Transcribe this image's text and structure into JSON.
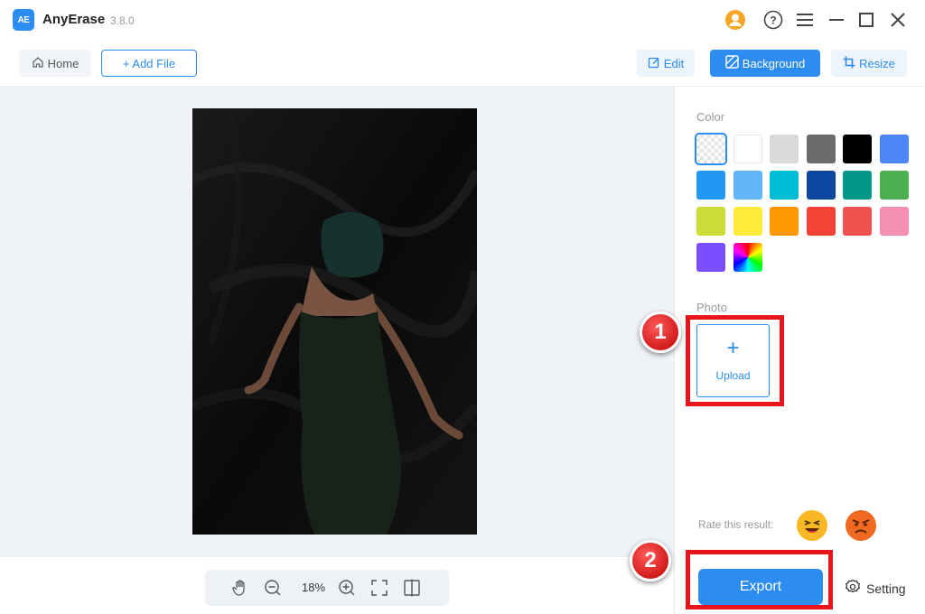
{
  "app": {
    "logo_text": "AE",
    "name": "AnyErase",
    "version": "3.8.0"
  },
  "titlebar_icons": [
    "user-avatar-icon",
    "help-icon",
    "menu-icon",
    "minimize-icon",
    "maximize-icon",
    "close-icon"
  ],
  "toolbar": {
    "home_label": "Home",
    "add_file_label": "+ Add File",
    "edit_label": "Edit",
    "background_label": "Background",
    "resize_label": "Resize"
  },
  "zoom": {
    "level": "18%"
  },
  "panel": {
    "color_title": "Color",
    "photo_title": "Photo",
    "upload_label": "Upload",
    "rate_label": "Rate this result:",
    "export_label": "Export",
    "setting_label": "Setting"
  },
  "colors": {
    "accent": "#2c8cf0",
    "swatches": [
      "transparent",
      "#ffffff",
      "#d9d9d9",
      "#6b6b6b",
      "#000000",
      "#4d86f7",
      "#2196f3",
      "#64b5f6",
      "#00bcd4",
      "#0d47a1",
      "#009688",
      "#4caf50",
      "#cddc39",
      "#ffeb3b",
      "#ff9800",
      "#f44336",
      "#ef5350",
      "#f48fb1",
      "#7c4dff",
      "rainbow"
    ]
  },
  "annotations": {
    "step1": "1",
    "step2": "2"
  }
}
